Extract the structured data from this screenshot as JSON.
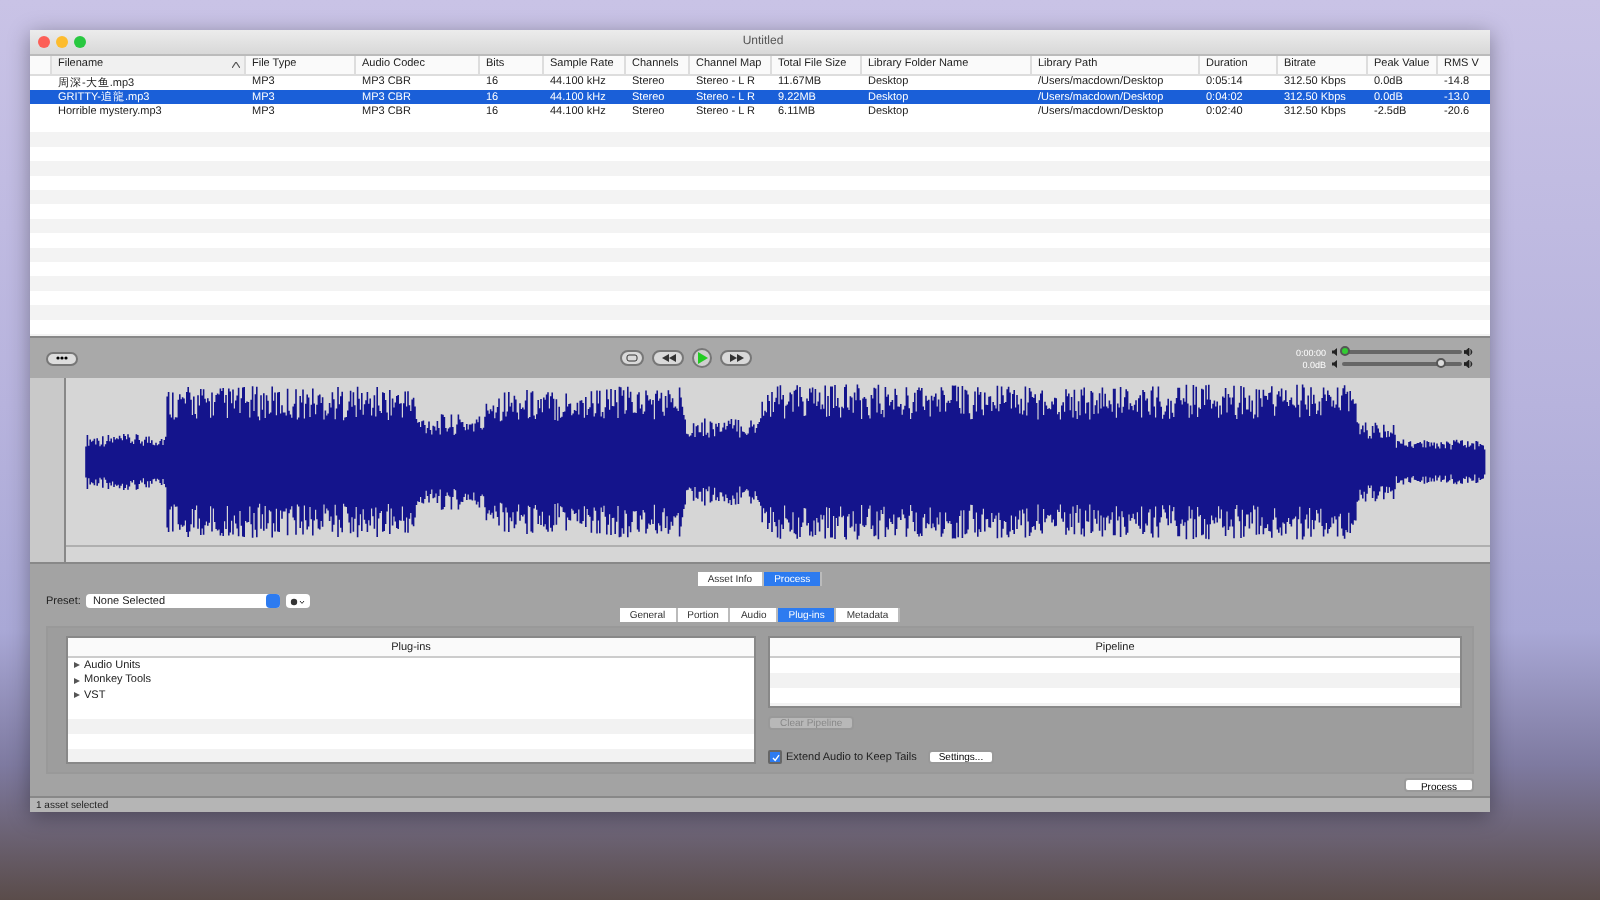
{
  "window": {
    "title": "Untitled"
  },
  "table": {
    "columns": [
      {
        "label": "Filename",
        "sorted": true
      },
      {
        "label": "File Type",
        "sorted": false
      },
      {
        "label": "Audio Codec",
        "sorted": false
      },
      {
        "label": "Bits",
        "sorted": false
      },
      {
        "label": "Sample Rate",
        "sorted": false
      },
      {
        "label": "Channels",
        "sorted": false
      },
      {
        "label": "Channel Map",
        "sorted": false
      },
      {
        "label": "Total File Size",
        "sorted": false
      },
      {
        "label": "Library Folder Name",
        "sorted": false
      },
      {
        "label": "Library Path",
        "sorted": false
      },
      {
        "label": "Duration",
        "sorted": false
      },
      {
        "label": "Bitrate",
        "sorted": false
      },
      {
        "label": "Peak Value",
        "sorted": false
      },
      {
        "label": "RMS V",
        "sorted": false
      }
    ],
    "rows": [
      {
        "selected": false,
        "cells": [
          "周深-大鱼.mp3",
          "MP3",
          "MP3 CBR",
          "16",
          "44.100 kHz",
          "Stereo",
          "Stereo - L R",
          "11.67MB",
          "Desktop",
          "/Users/macdown/Desktop",
          "0:05:14",
          "312.50 Kbps",
          "0.0dB",
          "-14.8"
        ]
      },
      {
        "selected": true,
        "cells": [
          "GRITTY-追龍.mp3",
          "MP3",
          "MP3 CBR",
          "16",
          "44.100 kHz",
          "Stereo",
          "Stereo - L R",
          "9.22MB",
          "Desktop",
          "/Users/macdown/Desktop",
          "0:04:02",
          "312.50 Kbps",
          "0.0dB",
          "-13.0"
        ]
      },
      {
        "selected": false,
        "cells": [
          "Horrible mystery.mp3",
          "MP3",
          "MP3 CBR",
          "16",
          "44.100 kHz",
          "Stereo",
          "Stereo - L R",
          "6.11MB",
          "Desktop",
          "/Users/macdown/Desktop",
          "0:02:40",
          "312.50 Kbps",
          "-2.5dB",
          "-20.6"
        ]
      }
    ]
  },
  "transport": {
    "position": {
      "reading": "0:00:00",
      "level": 0.03
    },
    "volume": {
      "reading": "0.0dB",
      "level": 0.82
    }
  },
  "view_tabs": [
    {
      "label": "Asset Info",
      "selected": false
    },
    {
      "label": "Process",
      "selected": true
    }
  ],
  "preset": {
    "label": "Preset:",
    "value": "None Selected"
  },
  "process_tabs": [
    {
      "label": "General",
      "selected": false
    },
    {
      "label": "Portion",
      "selected": false
    },
    {
      "label": "Audio",
      "selected": false
    },
    {
      "label": "Plug-ins",
      "selected": true
    },
    {
      "label": "Metadata",
      "selected": false
    }
  ],
  "plugins": {
    "title": "Plug-ins",
    "items": [
      {
        "label": "Audio Units",
        "expanded": false
      },
      {
        "label": "Monkey Tools",
        "expanded": false
      },
      {
        "label": "VST",
        "expanded": false
      }
    ]
  },
  "pipeline": {
    "title": "Pipeline",
    "clear_button": {
      "label": "Clear Pipeline",
      "disabled": true
    }
  },
  "extend_tails": {
    "label": "Extend Audio to Keep Tails",
    "checked": true
  },
  "settings_button": "Settings...",
  "process_button": "Process",
  "status_bar": "1 asset selected"
}
